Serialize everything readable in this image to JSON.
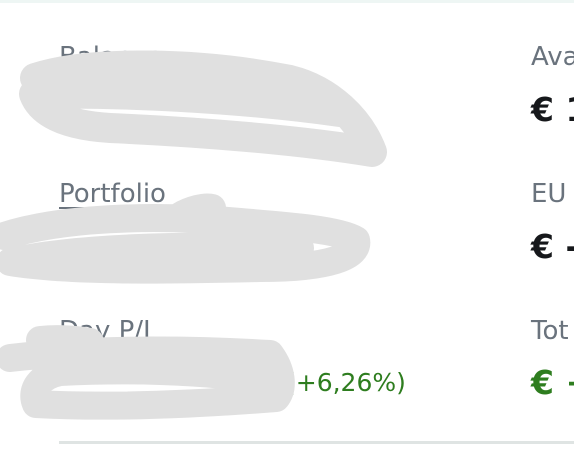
{
  "left": {
    "balance_label": "Balance",
    "portfolio_label": "Portfolio",
    "day_pl_label": "Day P/L",
    "day_pl_percent": "(+6,26%)"
  },
  "right": {
    "available_label_visible": "Ava",
    "available_value_visible": "€ 1",
    "eur_label_visible": "EU",
    "eur_value_visible": "€ -",
    "total_label_visible": "Tot",
    "total_value_visible": "€ +"
  },
  "colors": {
    "label_gray": "#6a737d",
    "value_dark": "#16181b",
    "positive_green": "#2e7d1f",
    "redaction_gray": "#e0e0e0"
  }
}
